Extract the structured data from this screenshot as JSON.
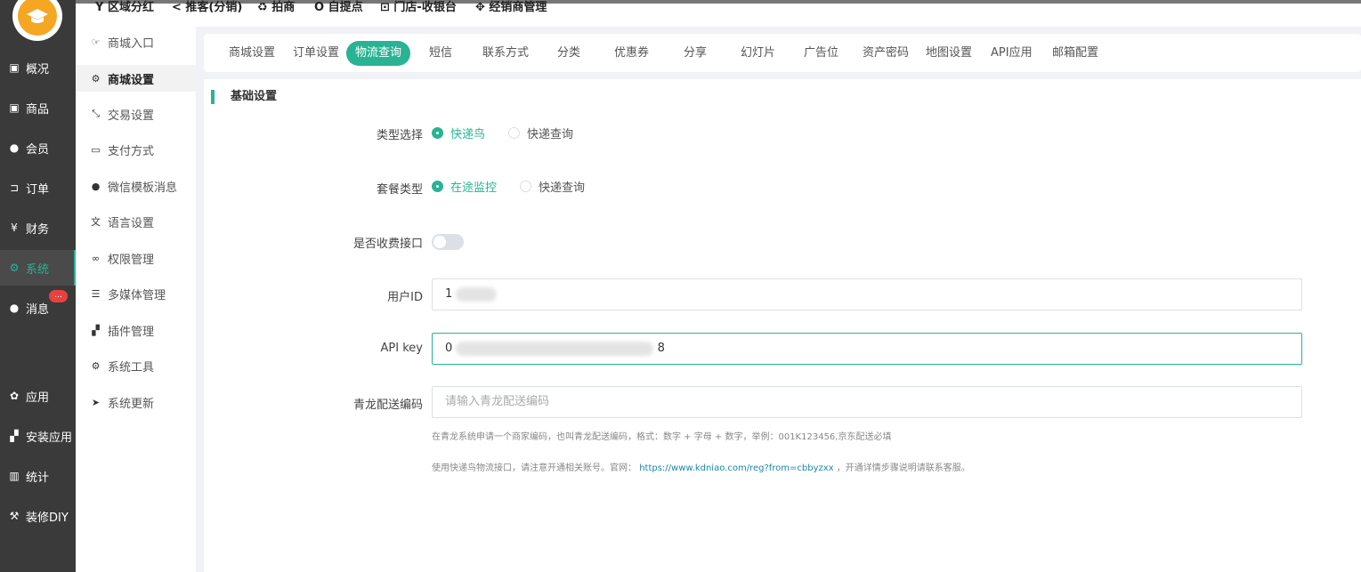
{
  "sidebar": {
    "items": [
      {
        "label": "概况",
        "icon": "dashboard-icon"
      },
      {
        "label": "商品",
        "icon": "goods-icon"
      },
      {
        "label": "会员",
        "icon": "users-icon"
      },
      {
        "label": "订单",
        "icon": "cart-icon"
      },
      {
        "label": "财务",
        "icon": "yen-icon"
      },
      {
        "label": "系统",
        "icon": "settings-icon",
        "active": true
      },
      {
        "label": "消息",
        "icon": "message-icon"
      },
      {
        "label": "应用",
        "icon": "apps-icon"
      },
      {
        "label": "安装应用",
        "icon": "puzzle-icon"
      },
      {
        "label": "统计",
        "icon": "chart-icon"
      },
      {
        "label": "装修DIY",
        "icon": "hammer-icon"
      }
    ],
    "message_badge": "..."
  },
  "topnav": {
    "items": [
      "区域分红",
      "推客(分销)",
      "拍商",
      "自提点",
      "门店-收银台",
      "经销商管理"
    ]
  },
  "subnav": {
    "items": [
      {
        "label": "商城入口",
        "icon": "hand-point-icon"
      },
      {
        "label": "商城设置",
        "icon": "gear-icon",
        "active": true
      },
      {
        "label": "交易设置",
        "icon": "exchange-icon"
      },
      {
        "label": "支付方式",
        "icon": "credit-card-icon"
      },
      {
        "label": "微信模板消息",
        "icon": "wechat-icon"
      },
      {
        "label": "语言设置",
        "icon": "language-icon"
      },
      {
        "label": "权限管理",
        "icon": "mask-icon"
      },
      {
        "label": "多媒体管理",
        "icon": "list-icon"
      },
      {
        "label": "插件管理",
        "icon": "plugin-icon"
      },
      {
        "label": "系统工具",
        "icon": "tool-icon"
      },
      {
        "label": "系统更新",
        "icon": "send-icon"
      }
    ]
  },
  "tabs": [
    "商城设置",
    "订单设置",
    "物流查询",
    "短信",
    "联系方式",
    "分类",
    "优惠券",
    "分享",
    "幻灯片",
    "广告位",
    "资产密码",
    "地图设置",
    "API应用",
    "邮箱配置"
  ],
  "active_tab": "物流查询",
  "form": {
    "section_title": "基础设置",
    "type_label": "类型选择",
    "type_options": [
      "快递鸟",
      "快递查询"
    ],
    "package_label": "套餐类型",
    "package_options": [
      "在途监控",
      "快递查询"
    ],
    "paid_label": "是否收费接口",
    "paid_enabled": false,
    "user_id_label": "用户ID",
    "user_id_value": "1",
    "api_key_label": "API key",
    "api_key_prefix": "0",
    "api_key_suffix": "8",
    "qinglong_label": "青龙配送编码",
    "qinglong_placeholder": "请输入青龙配送编码",
    "hint1": "在青龙系统申请一个商家编码，也叫青龙配送编码，格式：数字 + 字母 + 数字，举例：001K123456,京东配送必填",
    "hint2_prefix": "使用快递鸟物流接口，请注意开通相关账号。官网：",
    "hint2_link": "https://www.kdniao.com/reg?from=cbbyzxx",
    "hint2_suffix": "，开通详情步骤说明请联系客服。"
  },
  "colors": {
    "accent": "#29b394",
    "sidebar_bg": "#3a3a3a",
    "badge": "#e64340"
  }
}
